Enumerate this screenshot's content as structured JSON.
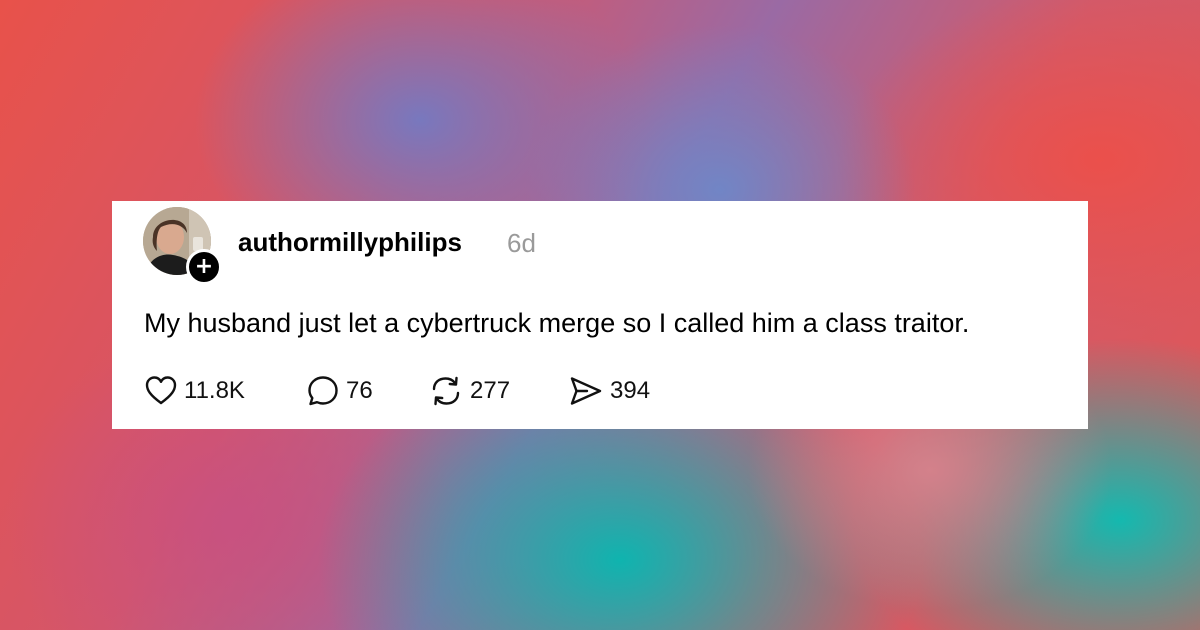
{
  "post": {
    "author": {
      "username": "authormillyphilips",
      "timestamp": "6d",
      "follow_badge": "+",
      "avatar_icon": "profile-photo"
    },
    "text": "My husband just let a cybertruck merge so I called him a class traitor.",
    "actions": {
      "like": {
        "icon": "heart-icon",
        "count": "11.8K"
      },
      "comment": {
        "icon": "comment-bubble-icon",
        "count": "76"
      },
      "repost": {
        "icon": "repost-icon",
        "count": "277"
      },
      "share": {
        "icon": "send-icon",
        "count": "394"
      }
    }
  },
  "colors": {
    "card_background": "#ffffff",
    "text": "#000000",
    "timestamp": "#9a9a9a",
    "background_red": "#e8524a",
    "background_teal": "#14b9af",
    "background_purple": "#7878be"
  }
}
